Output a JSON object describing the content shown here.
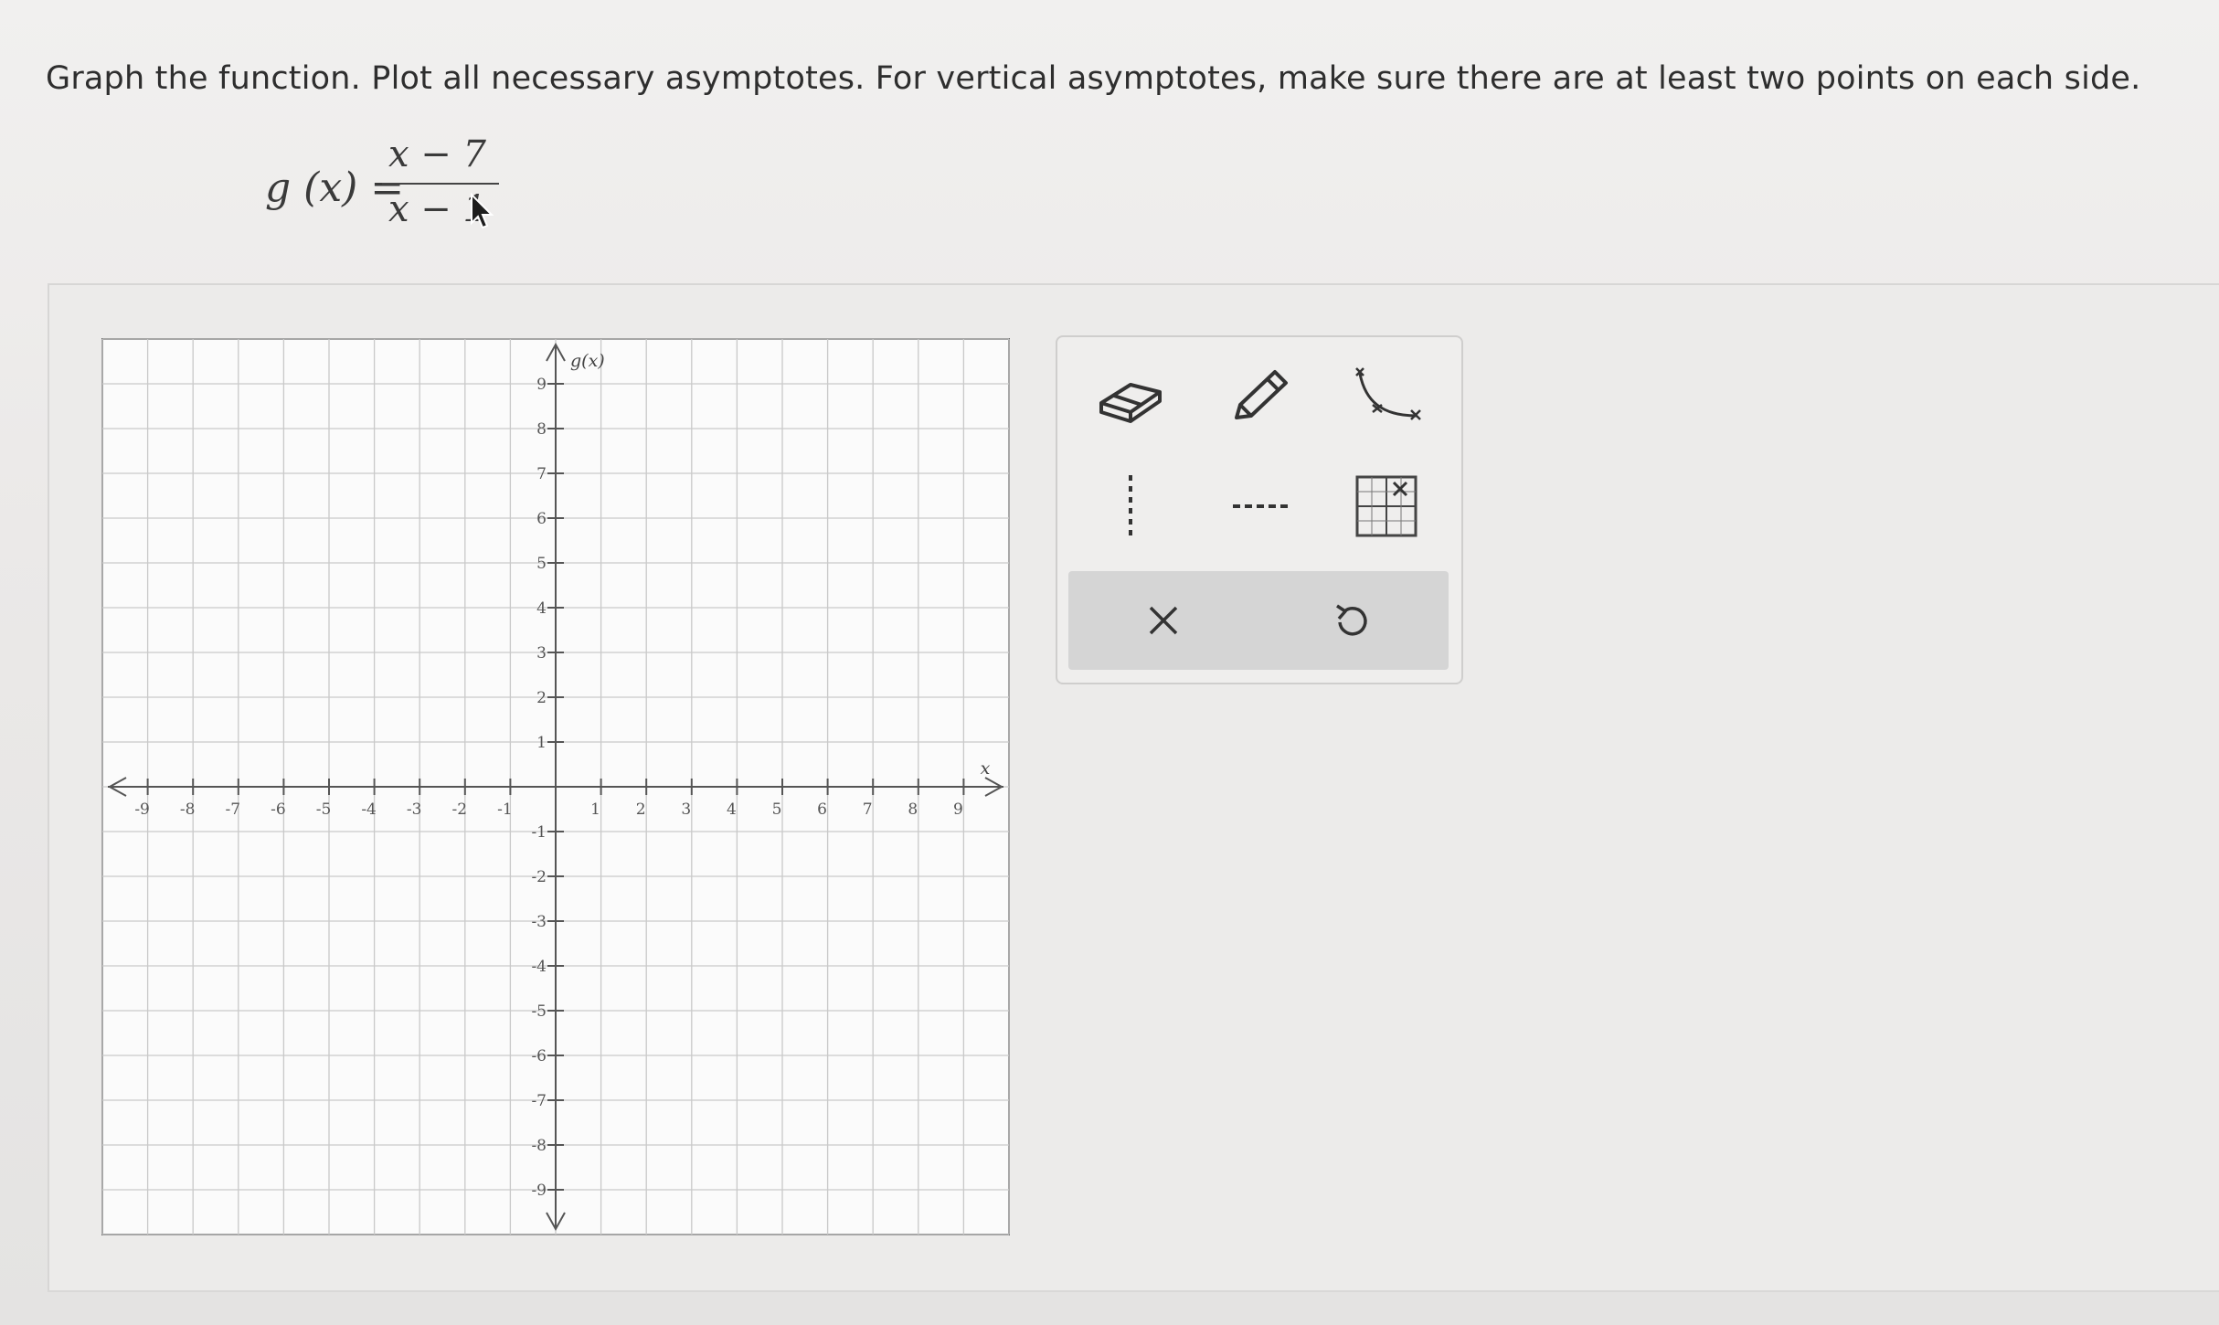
{
  "question": {
    "instructions": "Graph the function. Plot all necessary asymptotes. For vertical asymptotes, make sure there are at least two points on each side.",
    "function_lhs": "g (x) =",
    "numerator": "x − 7",
    "denominator": "x − 1"
  },
  "graph": {
    "x_axis_label": "x",
    "y_axis_label": "g(x)",
    "x_range": [
      -10,
      10
    ],
    "y_range": [
      -10,
      10
    ],
    "x_tick_labels": [
      "-9",
      "-8",
      "-7",
      "-6",
      "-5",
      "-4",
      "-3",
      "-2",
      "-1",
      "1",
      "2",
      "3",
      "4",
      "5",
      "6",
      "7",
      "8",
      "9"
    ],
    "y_tick_labels": [
      "9",
      "8",
      "7",
      "6",
      "5",
      "4",
      "3",
      "2",
      "1",
      "-1",
      "-2",
      "-3",
      "-4",
      "-5",
      "-6",
      "-7",
      "-8",
      "-9"
    ],
    "gridlines": true
  },
  "toolbox": {
    "tools": [
      "eraser-icon",
      "pencil-icon",
      "curve-tool-icon",
      "vertical-asymptote-icon",
      "horizontal-asymptote-icon",
      "graph-grid-icon"
    ],
    "actions": [
      "clear-icon",
      "undo-icon"
    ]
  },
  "colors": {
    "grid": "#c9c9c9",
    "axis": "#555555",
    "panel_bg": "#ecebea",
    "action_bar": "#d5d5d5"
  }
}
